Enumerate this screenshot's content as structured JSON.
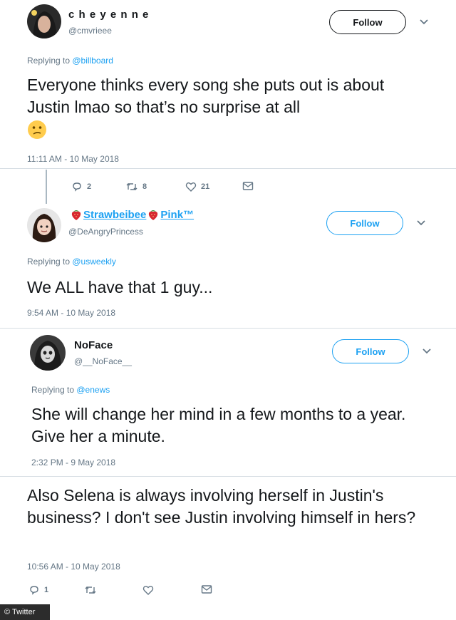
{
  "tweets": [
    {
      "name": "c h e y e n n e",
      "handle": "@cmvrieee",
      "follow": "Follow",
      "replying_prefix": "Replying to ",
      "replying_to": "@billboard",
      "text": "Everyone thinks every song she puts out is about Justin lmao so that’s no surprise at all",
      "emoji": "confused-face",
      "time": "11:11 AM - 10 May 2018",
      "actions": {
        "reply": "2",
        "retweet": "8",
        "like": "21"
      }
    },
    {
      "name_left_emoji": "strawberry",
      "name": "Strawbeibee",
      "name_right_emoji": "strawberry",
      "name_suffix": "Pink™",
      "handle": "@DeAngryPrincess",
      "follow": "Follow",
      "replying_prefix": "Replying to ",
      "replying_to": "@usweekly",
      "text": "We ALL have that 1 guy...",
      "time": "9:54 AM - 10 May 2018"
    },
    {
      "name": "NoFace",
      "handle": "@__NoFace__",
      "follow": "Follow",
      "replying_prefix": "Replying to ",
      "replying_to": "@enews",
      "text": "She will change her mind in a few months to a year. Give her a minute.",
      "time": "2:32 PM - 9 May 2018"
    },
    {
      "text": "Also Selena is always involving herself in Justin's business? I don't see Justin involving himself in hers?",
      "time": "10:56 AM - 10 May 2018",
      "actions": {
        "reply": "1"
      }
    }
  ],
  "watermark": "© Twitter",
  "colors": {
    "accent": "#1da1f2",
    "muted": "#657786",
    "text": "#14171a"
  }
}
